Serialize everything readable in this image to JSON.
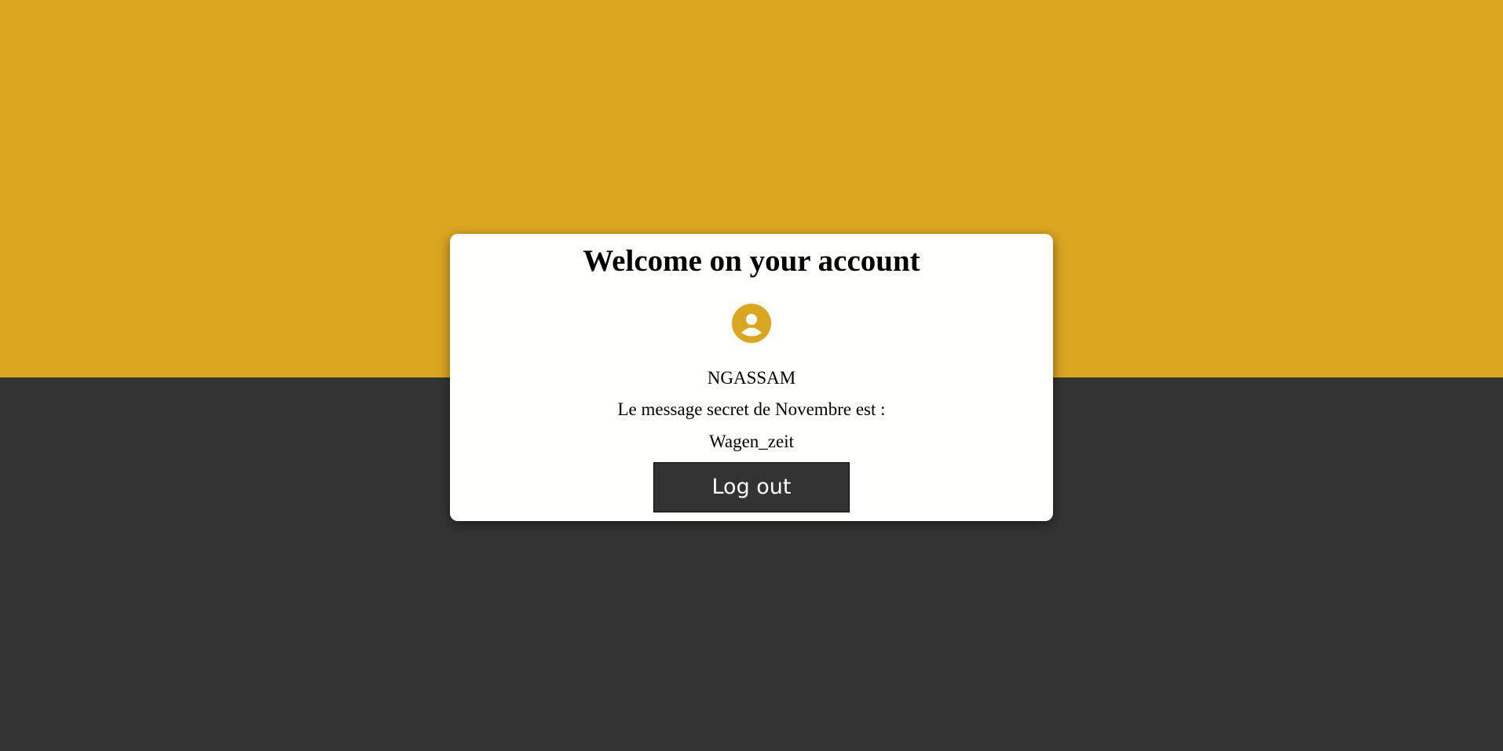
{
  "colors": {
    "accent": "#DAA520",
    "dark": "#333333",
    "card": "#FEFEFA"
  },
  "card": {
    "title": "Welcome on your account",
    "avatar_icon": "user-circle-icon",
    "username": "NGASSAM",
    "message_label": "Le message secret de Novembre est :",
    "message_value": "Wagen_zeit",
    "logout_label": "Log out"
  }
}
